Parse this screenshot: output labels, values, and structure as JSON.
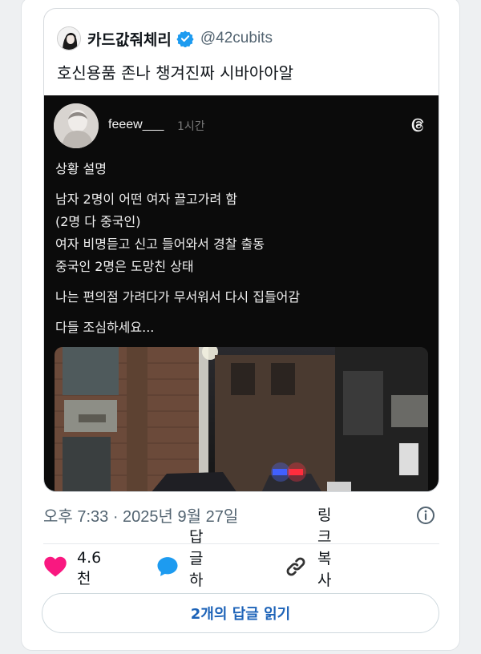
{
  "quoted_tweet": {
    "display_name": "카드값줘체리",
    "handle": "@42cubits",
    "text": "호신용품 존나 챙겨진짜 시바아아알"
  },
  "threads_post": {
    "username": "feeew___",
    "time": "1시간",
    "lines": [
      "상황 설명",
      "남자 2명이 어떤 여자 끌고가려 함",
      "(2명 다 중국인)",
      "여자 비명듣고 신고 들어와서 경찰 출동",
      "중국인 2명은 도망친 상태",
      "나는 편의점 가려다가 무서워서 다시 집들어감",
      "다들 조심하세요..."
    ]
  },
  "meta": {
    "timestamp": "오후 7:33 · 2025년 9월 27일"
  },
  "actions": {
    "likes": "4.6천",
    "reply": "답글하기",
    "copy_link": "링크 복사하기"
  },
  "read_replies": "2개의 답글 읽기",
  "colors": {
    "like": "#f91880",
    "reply_icon": "#1d9bf0",
    "verified": "#1d9bf0",
    "link": "#1d63b8"
  }
}
